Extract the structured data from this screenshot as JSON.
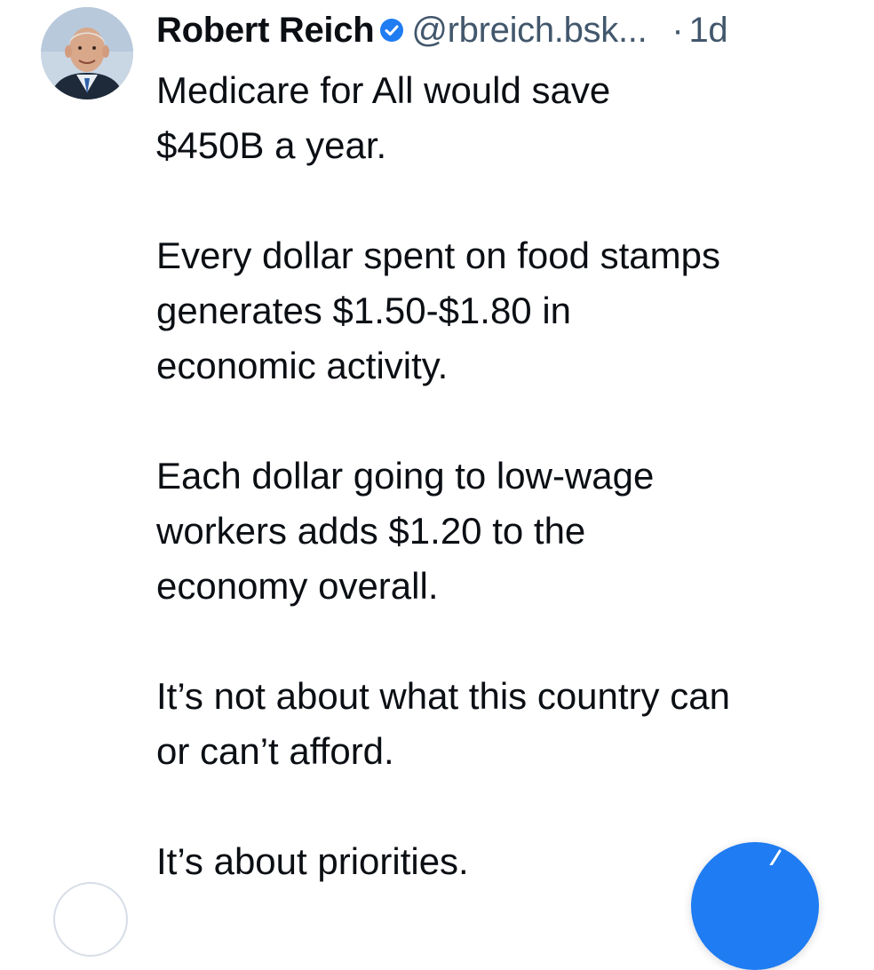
{
  "post": {
    "author_name": "Robert Reich",
    "handle": "@rbreich.bsk...",
    "separator": "·",
    "timestamp": "1d",
    "verified": true,
    "paragraphs": [
      "Medicare for All would save\n$450B a year.",
      "Every dollar spent on food stamps\ngenerates $1.50-$1.80 in\neconomic activity.",
      "Each dollar going to low-wage\nworkers adds $1.20 to the\neconomy overall.",
      "It’s not about what this country can\nor can’t afford.",
      "It’s about priorities."
    ]
  },
  "icons": {
    "verified": "verified-badge-icon",
    "compose": "compose-icon"
  },
  "colors": {
    "text": "#0b0f14",
    "secondary": "#42576c",
    "accent": "#1f7cf2",
    "background": "#ffffff"
  }
}
